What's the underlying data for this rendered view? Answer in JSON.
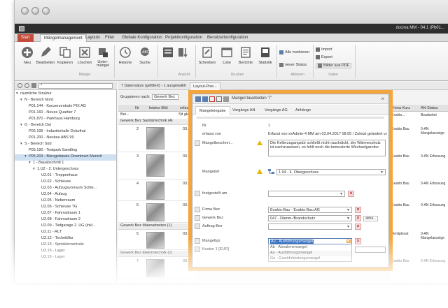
{
  "app": {
    "title": "docma MM - 04.1 (Pb01..."
  },
  "ribbon_tabs": [
    "Start",
    "Mängelmanagement",
    "Layouts",
    "Filter",
    "Globale Konfiguration",
    "Projektkonfiguration",
    "Benutzerkonfiguration"
  ],
  "ribbon": {
    "group_maengel_label": "Mängel",
    "group_ansicht_label": "Ansicht",
    "group_drucken_label": "Drucken",
    "group_aktionen_label": "Aktionen",
    "group_daten_label": "Daten",
    "neu": "Neu",
    "bearbeiten": "Bearbeiten",
    "kopieren": "Kopieren",
    "loeschen": "Löschen",
    "unter_maengel": "Unter-\nmängel",
    "historie": "Historie",
    "suche": "Suche",
    "schreiben": "Schreiben",
    "liste": "Liste",
    "berichte": "Berichte",
    "statistik": "Statistik",
    "alle_markieren": "Alle markieren",
    "neuer_status": "neuer Status",
    "import": "Import",
    "export": "Export",
    "bilder_aus_pdf": "Bilder aus PDF"
  },
  "tree": {
    "search_value": "*",
    "nodes": [
      "räumliche Struktur",
      "N - Bereich Nord",
      "P01.144 - Konzerzentrale PIX AG",
      "P01.160 - Neues Quartier 7",
      "P01.870 - Parkhaus Hamburg",
      "O - Bereich Ost",
      "P05.199 - Industriehalle Dokuthal",
      "P01.200 - Neubau ABS 99",
      "S - Bereich Süd",
      "P05.190 - Testpark Sandling",
      "P05.203 - Bürogebäude Downtown Munich",
      "1 - Bauabschnitt 1",
      "1.U2 - 2. Untergeschoss",
      "U2.01 - Treppenhaus",
      "U2.02 - Schleuse",
      "U2.03 - Aufzugsvorraum Schle...",
      "U2.04 - Aufzug",
      "U2.05 - Nebenraum",
      "U2.06 - Schleuse TG",
      "U2.07 - Fahrradraum 1",
      "U2.08 - Fahrradraum 2",
      "U2.09 - Tiefgarage 2. UG (inkl...",
      "U2.11 - RLT",
      "U2.12 - Technikflur",
      "U2.13 - Sprinklerzentrale",
      "U2.15 - Lager",
      "U2.16 - Lager"
    ]
  },
  "middle": {
    "count_text": "7 Datensätze (gefiltert) - 1 ausgewählt",
    "list_tab": "Layout-Pixe...",
    "group_by_label": "Gruppieren nach:",
    "group_by_value": "Gewerk Bez",
    "col_nr": "Nr",
    "col_bild": "letztes Bild",
    "col_erf": "erfass",
    "filter_row_bei": "Bei...",
    "filter_row_sit": "Sit gleic",
    "group1": "Gewerk Bez Sanitärtechnik (4)",
    "group2": "Gewerk Bez Malerarbeiten (1)",
    "group3": "Gewerk Bez Elektrotechnik (1)",
    "row_nrs": [
      "2",
      "3",
      "4",
      "6",
      "5",
      "7"
    ],
    "row_dates": [
      "03.0",
      "03.0",
      "03.0",
      "03.0",
      "03.0",
      "03.0"
    ]
  },
  "right_cols": {
    "col_firma": "Firma Kurz",
    "col_status": "AN Status",
    "filter_firma": "Exakto...",
    "filter_status": "Bearbeitet",
    "rows": [
      {
        "firma": "Exakto Bau",
        "status": "0-AN Mangelanzeige"
      },
      {
        "firma": "Exakto Bau",
        "status": "0-AN Erfassung"
      },
      {
        "firma": "Exakto Bau",
        "status": "0-AN Erfassung"
      },
      {
        "firma": "Exakto Bau",
        "status": "0-AN Erfassung"
      },
      {
        "firma": "Ventiplexat",
        "status": "0-AN Mangelanzeige"
      },
      {
        "firma": "Exakto Bau",
        "status": "0-AN Erfassung"
      }
    ]
  },
  "dialog": {
    "title": "Mangel bearbeiten '7'",
    "tabs": [
      "Mangeleingabe",
      "Vorgänge AN",
      "Vorgänge AG",
      "Anhänge"
    ],
    "fields": {
      "nr_label": "Nr",
      "nr_value": "1",
      "erfasst_label": "erfasst von",
      "erfasst_value": "Erfasst von xxAdmin-4 MM am 03.04.2017 08:55 / Zuletzt geändert von",
      "beschreibung_label": "Mangelbeschrei...",
      "beschreibung_value": "Die Kellerzugangstür schließt nicht rauchdicht, der Wärmeschutz ist nachzuweisen, es fehlt noch die bemusterte Wechselgarnitur",
      "mangelort_label": "Mangelort",
      "mangelort_value": "1.04 - 4. Obergeschoss",
      "festgestellt_label": "festgestellt am",
      "festgestellt_value": "",
      "firma_label": "Firma Bez",
      "firma_value": "Exakto-Bau - Exakto-Bau AG",
      "gewerk_label": "Gewerk Bez",
      "gewerk_value": "047 - Dämm-/Brandschutz",
      "gewerk_extra": "abhä...",
      "auftrag_label": "Auftrag Bez",
      "auftrag_value": "",
      "mangeltyp_label": "Mangeltyp",
      "mangeltyp_value": "Au - Ausführungsmangel",
      "kosten_label": "Kosten 1 [EUR]"
    },
    "dropdown_options": [
      "Ab - Abnahmemangel",
      "Au - Ausführungsmangel",
      "Ge - Gewährleistungsmangel"
    ]
  },
  "colors": {
    "dialog_highlight": "#f4a53c",
    "start_tab": "#c44a3a",
    "selection": "#cfe0f3",
    "delete_red": "#c3302b"
  }
}
